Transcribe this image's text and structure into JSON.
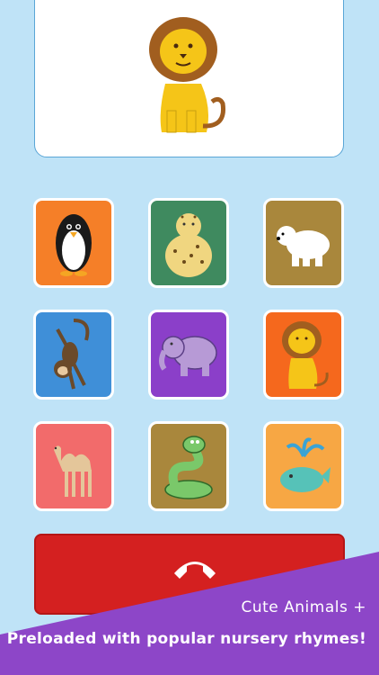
{
  "display": {
    "animal": "lion",
    "icon": "lion-icon"
  },
  "tiles": [
    {
      "animal": "penguin",
      "color": "#f57f28"
    },
    {
      "animal": "leopard",
      "color": "#3f8a5f"
    },
    {
      "animal": "polar-bear",
      "color": "#a9873c"
    },
    {
      "animal": "monkey",
      "color": "#3f8fd8"
    },
    {
      "animal": "elephant",
      "color": "#8b3fc9"
    },
    {
      "animal": "lion",
      "color": "#f5681d"
    },
    {
      "animal": "camel",
      "color": "#f26b6b"
    },
    {
      "animal": "snake",
      "color": "#a9873c"
    },
    {
      "animal": "whale",
      "color": "#f7a744"
    }
  ],
  "hangup": {
    "icon": "phone-hangup-icon",
    "color": "#d42020"
  },
  "banner": {
    "line1": "Cute Animals +",
    "line2": "Preloaded with popular nursery rhymes!",
    "color": "#8d46c8"
  }
}
